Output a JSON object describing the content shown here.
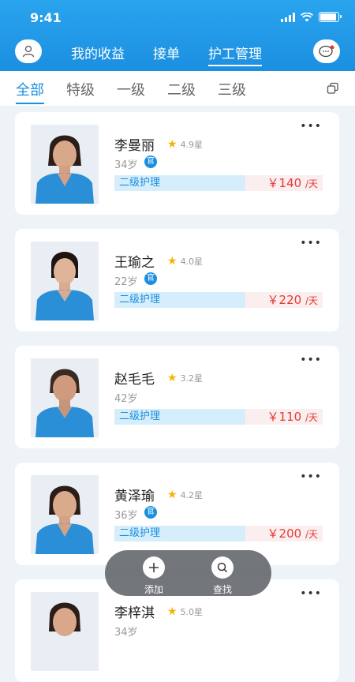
{
  "status_bar": {
    "time": "9:41"
  },
  "header": {
    "tabs": [
      {
        "label": "我的收益",
        "active": false
      },
      {
        "label": "接单",
        "active": false
      },
      {
        "label": "护工管理",
        "active": true
      }
    ],
    "accent_color": "#1b8fe0"
  },
  "filter": {
    "tabs": [
      {
        "label": "全部",
        "active": true
      },
      {
        "label": "特级",
        "active": false
      },
      {
        "label": "一级",
        "active": false
      },
      {
        "label": "二级",
        "active": false
      },
      {
        "label": "三级",
        "active": false
      }
    ]
  },
  "caregivers": [
    {
      "name": "李曼丽",
      "rating": "4.9星",
      "age": "34岁",
      "official": "官",
      "level": "二级护理",
      "price": "￥140",
      "unit": "/天"
    },
    {
      "name": "王瑜之",
      "rating": "4.0星",
      "age": "22岁",
      "official": "官",
      "level": "二级护理",
      "price": "￥220",
      "unit": "/天"
    },
    {
      "name": "赵毛毛",
      "rating": "3.2星",
      "age": "42岁",
      "official": "",
      "level": "二级护理",
      "price": "￥110",
      "unit": "/天"
    },
    {
      "name": "黄泽瑜",
      "rating": "4.2星",
      "age": "36岁",
      "official": "官",
      "level": "二级护理",
      "price": "￥200",
      "unit": "/天"
    },
    {
      "name": "李梓淇",
      "rating": "5.0星",
      "age": "34岁",
      "official": "",
      "level": "",
      "price": "",
      "unit": ""
    }
  ],
  "float_bar": {
    "add_label": "添加",
    "search_label": "查找"
  },
  "icons": {
    "user": "user-icon",
    "message": "message-icon",
    "copy": "copy-icon",
    "more": "more-icon",
    "star": "star-icon",
    "add": "plus-icon",
    "search": "search-icon"
  }
}
